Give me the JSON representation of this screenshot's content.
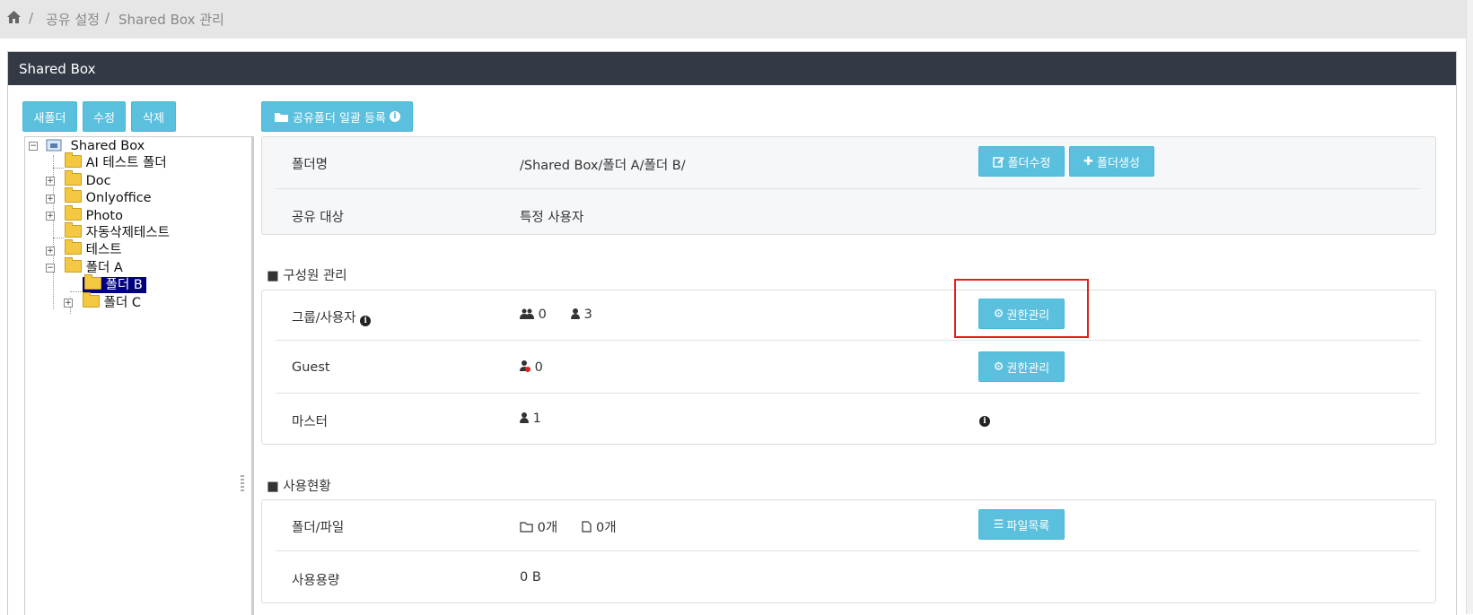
{
  "breadcrumb": {
    "home_icon": "home-icon",
    "sep": "/",
    "items": [
      "공유 설정",
      "Shared Box 관리"
    ]
  },
  "panel": {
    "title": "Shared Box"
  },
  "toolbar": {
    "new_folder": "새폴더",
    "edit": "수정",
    "delete": "삭제",
    "bulk_register": "공유폴더 일괄 등록"
  },
  "tree": {
    "root": "Shared Box",
    "nodes": [
      "AI 테스트 폴더",
      "Doc",
      "Onlyoffice",
      "Photo",
      "자동삭제테스트",
      "테스트",
      "폴더 A",
      "폴더 B",
      "폴더 C"
    ]
  },
  "folder_info": {
    "name_label": "폴더명",
    "name_value": "/Shared Box/폴더 A/폴더 B/",
    "edit_button": "폴더수정",
    "create_button": "폴더생성",
    "target_label": "공유 대상",
    "target_value": "특정 사용자"
  },
  "members": {
    "title": "■ 구성원 관리",
    "rows": [
      {
        "label": "그룹/사용자",
        "group_count": "0",
        "user_count": "3",
        "button": "권한관리"
      },
      {
        "label": "Guest",
        "count": "0",
        "button": "권한관리"
      },
      {
        "label": "마스터",
        "count": "1"
      }
    ]
  },
  "usage": {
    "title": "■ 사용현황",
    "folder_file_label": "폴더/파일",
    "folder_count": "0개",
    "file_count": "0개",
    "file_list_button": "파일목록",
    "capacity_label": "사용용량",
    "capacity_value": "0 B"
  },
  "colors": {
    "header_bg": "#343a45",
    "button": "#5bc0de",
    "highlight": "#e02020",
    "selected": "#000080"
  }
}
